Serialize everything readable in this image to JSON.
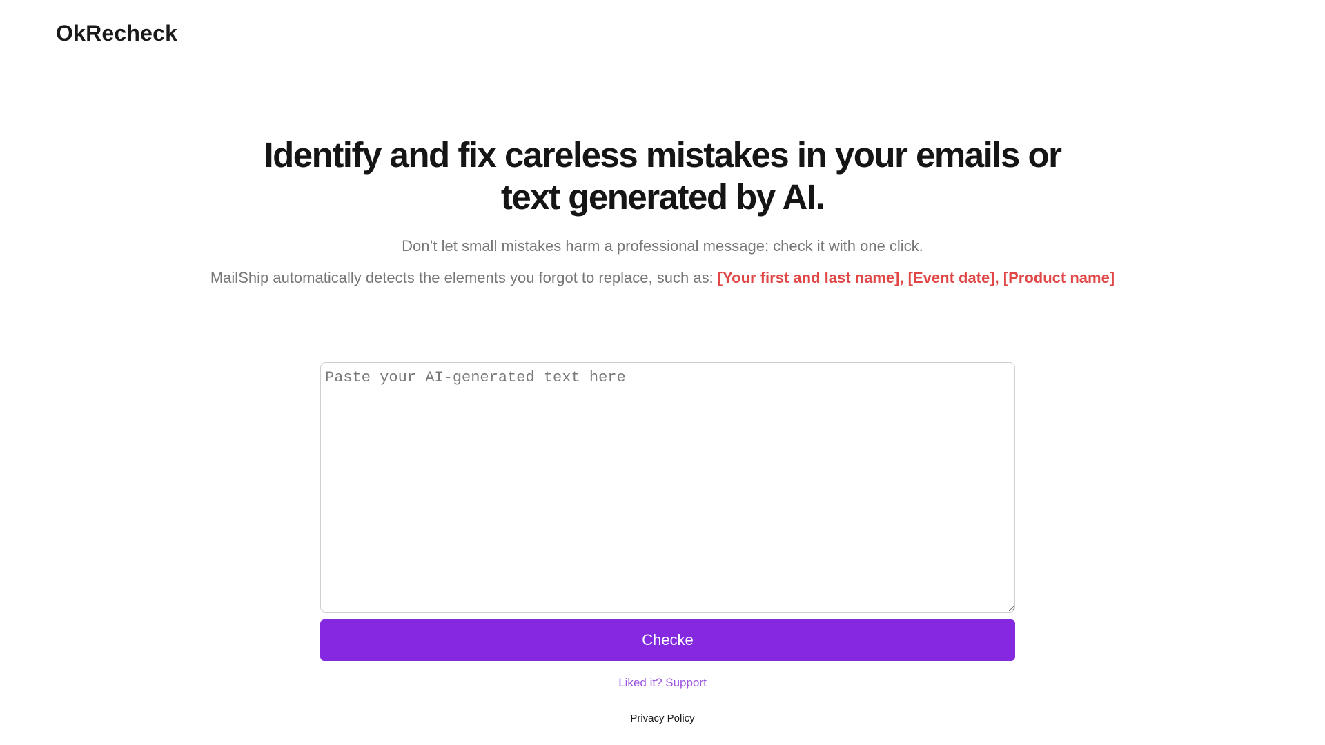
{
  "header": {
    "brand": "OkRecheck"
  },
  "hero": {
    "title": "Identify and fix careless mistakes in your emails or text generated by AI.",
    "subtitle": "Don’t let small mistakes harm a professional message: check it with one click.",
    "detect_prefix": "MailShip automatically detects the elements you forgot to replace, such as: ",
    "detect_examples": "[Your first and last name], [Event date], [Product name]"
  },
  "form": {
    "input_value": "",
    "input_placeholder": "Paste your AI-generated text here",
    "submit_label": "Checke"
  },
  "footer": {
    "support_label": "Liked it? Support",
    "privacy_label": "Privacy Policy"
  },
  "colors": {
    "accent": "#8529e0",
    "support_link": "#9b55e0",
    "highlight": "#e04848",
    "muted_text": "#777777"
  }
}
